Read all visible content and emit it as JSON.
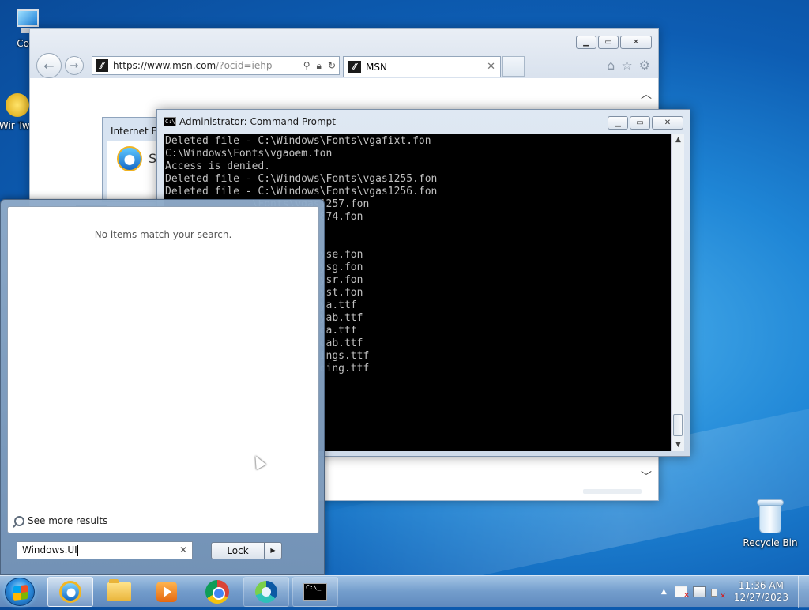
{
  "desktop": {
    "icons": [
      {
        "label": "Com"
      },
      {
        "label": "Wir Twe"
      },
      {
        "label": "Recycle Bin"
      }
    ]
  },
  "ie": {
    "url_domain": "https://www.msn.com",
    "url_rest": "/?ocid=iehp",
    "tab_title": "MSN",
    "fav_glyph": "⁄⁄",
    "dialog_title": "Internet Explorer",
    "dialog_text": "Se"
  },
  "cmd": {
    "title": "Administrator: Command Prompt",
    "lines": [
      "Deleted file - C:\\Windows\\Fonts\\vgafixt.fon",
      "C:\\Windows\\Fonts\\vgaoem.fon",
      "Access is denied.",
      "Deleted file - C:\\Windows\\Fonts\\vgas1255.fon",
      "Deleted file - C:\\Windows\\Fonts\\vgas1256.fon",
      "              \\Fonts\\vgas1257.fon",
      "              \\Fonts\\vgas874.fon",
      "              fon",
      "",
      "              \\Fonts\\vgasyse.fon",
      "              \\Fonts\\vgasysg.fon",
      "              \\Fonts\\vgasysr.fon",
      "              \\Fonts\\vgasyst.fon",
      "              \\Fonts\\vijaya.ttf",
      "              \\Fonts\\vijayab.ttf",
      "              \\Fonts\\vrinda.ttf",
      "              \\Fonts\\vrindab.ttf",
      "              \\Fonts\\webdings.ttf",
      "              \\Fonts\\wingding.ttf"
    ]
  },
  "start_menu": {
    "no_results": "No items match your search.",
    "see_more": "See more results",
    "search_value": "Windows.UI",
    "lock_label": "Lock"
  },
  "taskbar": {
    "apps": [
      {
        "name": "Internet Explorer",
        "active": true
      },
      {
        "name": "Windows Explorer",
        "active": false
      },
      {
        "name": "Windows Media Player",
        "active": false
      },
      {
        "name": "Google Chrome",
        "active": false
      },
      {
        "name": "Microsoft Edge",
        "active": true
      },
      {
        "name": "Command Prompt",
        "active": true
      }
    ],
    "clock_time": "11:36 AM",
    "clock_date": "12/27/2023"
  }
}
